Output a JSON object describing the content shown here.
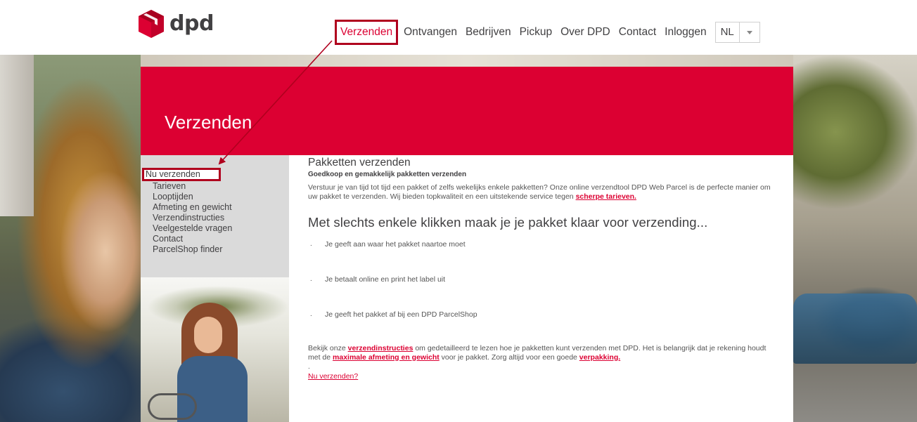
{
  "header": {
    "logo_text": "dpd",
    "nav": [
      {
        "label": "Verzenden"
      },
      {
        "label": "Ontvangen"
      },
      {
        "label": "Bedrijven"
      },
      {
        "label": "Pickup"
      },
      {
        "label": "Over DPD"
      },
      {
        "label": "Contact"
      },
      {
        "label": "Inloggen"
      }
    ],
    "language": {
      "selected": "NL"
    }
  },
  "banner": {
    "title": "Verzenden"
  },
  "sidebar": {
    "items": [
      {
        "label": "Nu verzenden"
      },
      {
        "label": "Tarieven"
      },
      {
        "label": "Looptijden"
      },
      {
        "label": "Afmeting en gewicht"
      },
      {
        "label": "Verzendinstructies"
      },
      {
        "label": "Veelgestelde vragen"
      },
      {
        "label": "Contact"
      },
      {
        "label": "ParcelShop finder"
      }
    ]
  },
  "main": {
    "heading": "Pakketten verzenden",
    "subheading": "Goedkoop en gemakkelijk pakketten verzenden",
    "intro_text": "Verstuur je van tijd tot tijd een pakket of zelfs wekelijks enkele pakketten? Onze online verzendtool DPD Web Parcel is de perfecte manier om uw pakket te verzenden. Wij bieden topkwaliteit en een uitstekende service tegen",
    "intro_link": "scherpe tarieven.",
    "steps_heading": "Met slechts enkele klikken maak je je pakket klaar voor verzending...",
    "steps": [
      {
        "bullet": ".",
        "text": "Je geeft aan waar het pakket naartoe moet"
      },
      {
        "bullet": ".",
        "text": "Je betaalt online en print het label uit"
      },
      {
        "bullet": ".",
        "text": "Je geeft het pakket af bij een DPD ParcelShop"
      }
    ],
    "footer": {
      "part1": "Bekijk onze",
      "link1": "verzendinstructies",
      "part2": "om gedetailleerd te lezen hoe je pakketten kunt verzenden met DPD. Het is belangrijk dat je rekening houdt met de",
      "link2": "maximale afmeting en gewicht",
      "part3": "voor je pakket. Zorg altijd voor een goede",
      "link3": "verpakking.",
      "dot": ".",
      "cta": "Nu verzenden?"
    }
  },
  "colors": {
    "brand_red": "#dc0032",
    "annotation_red": "#b0001e",
    "sidebar_gray": "#dadada",
    "text_dark": "#414042"
  }
}
